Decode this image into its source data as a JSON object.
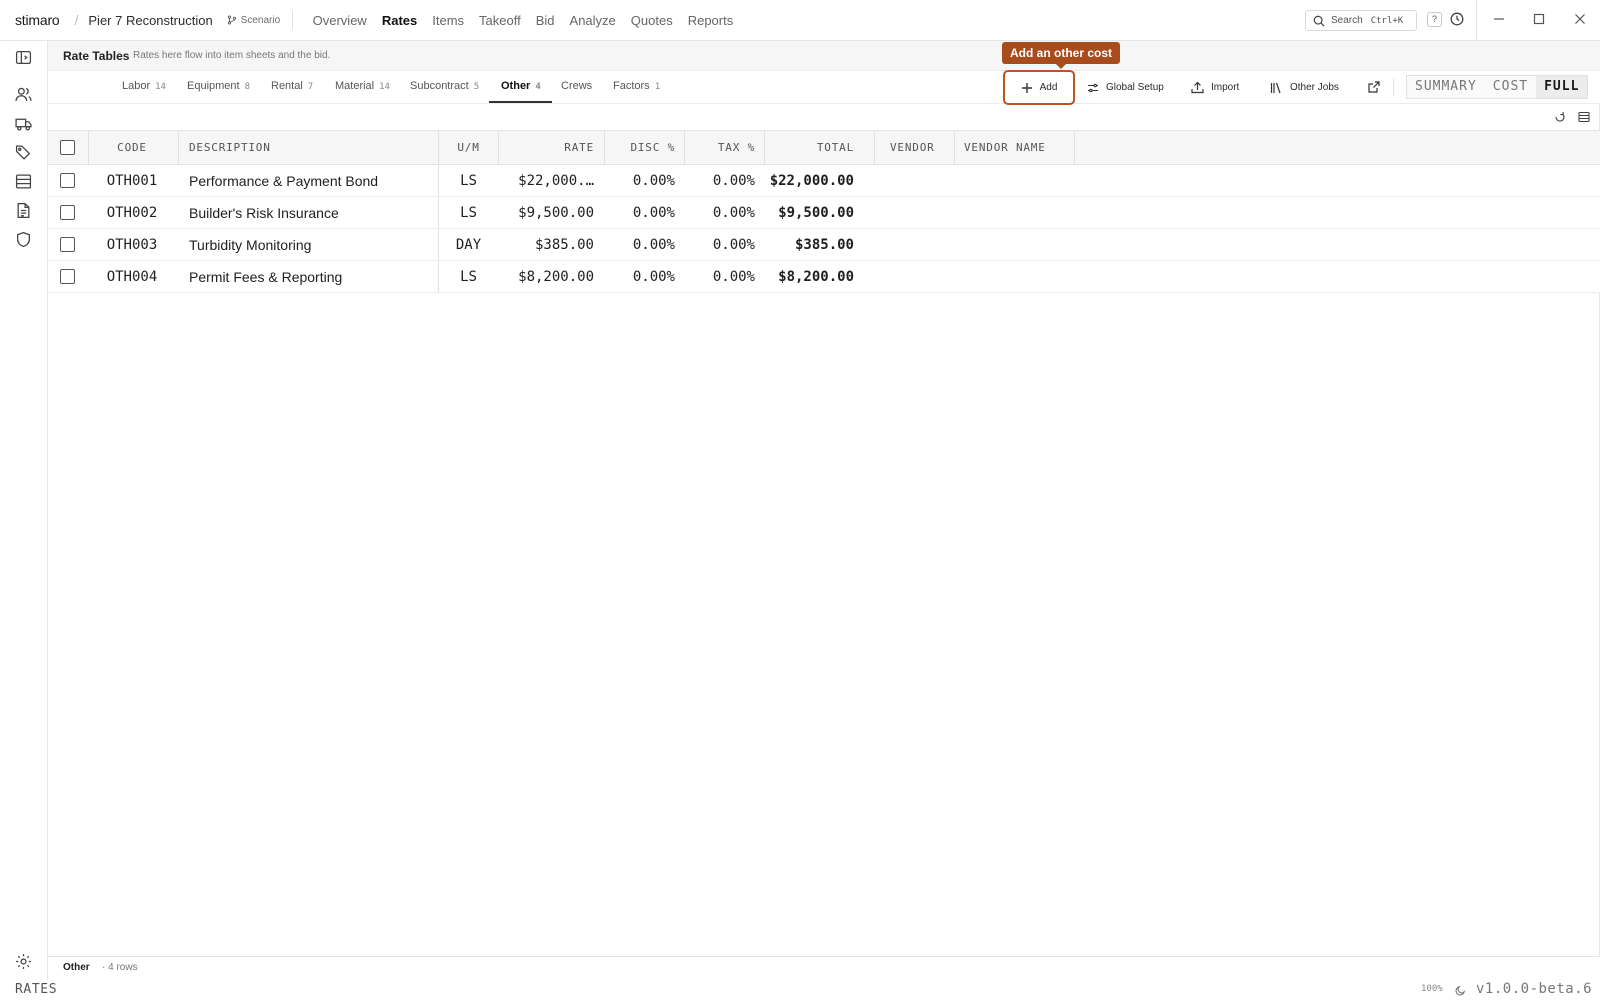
{
  "app": {
    "brand": "stimaro",
    "separator": "/",
    "project": "Pier 7 Reconstruction",
    "scenario": "Scenario"
  },
  "nav": [
    "Overview",
    "Rates",
    "Items",
    "Takeoff",
    "Bid",
    "Analyze",
    "Quotes",
    "Reports"
  ],
  "nav_active": "Rates",
  "search": {
    "label": "Search",
    "shortcut": "Ctrl+K"
  },
  "help_label": "?",
  "header": {
    "title": "Rate Tables",
    "subtitle": "Rates here flow into item sheets and the bid."
  },
  "tabs": [
    {
      "label": "Labor",
      "count": "14"
    },
    {
      "label": "Equipment",
      "count": "8"
    },
    {
      "label": "Rental",
      "count": "7"
    },
    {
      "label": "Material",
      "count": "14"
    },
    {
      "label": "Subcontract",
      "count": "5"
    },
    {
      "label": "Other",
      "count": "4"
    },
    {
      "label": "Crews",
      "count": ""
    },
    {
      "label": "Factors",
      "count": "1"
    }
  ],
  "active_tab": "Other",
  "toolbar": {
    "tooltip": "Add an other cost",
    "add": "Add",
    "global_setup": "Global Setup",
    "import": "Import",
    "other_jobs": "Other Jobs"
  },
  "view_modes": [
    "SUMMARY",
    "COST",
    "FULL"
  ],
  "view_active": "FULL",
  "table": {
    "columns": {
      "code": "CODE",
      "description": "DESCRIPTION",
      "um": "U/M",
      "rate": "RATE",
      "disc": "DISC %",
      "tax": "TAX %",
      "total": "TOTAL",
      "vendor": "VENDOR",
      "vendor_name": "VENDOR NAME"
    },
    "rows": [
      {
        "code": "OTH001",
        "description": "Performance & Payment Bond",
        "um": "LS",
        "rate": "$22,000.…",
        "disc": "0.00%",
        "tax": "0.00%",
        "total": "$22,000.00",
        "vendor": "",
        "vendor_name": ""
      },
      {
        "code": "OTH002",
        "description": "Builder's Risk Insurance",
        "um": "LS",
        "rate": "$9,500.00",
        "disc": "0.00%",
        "tax": "0.00%",
        "total": "$9,500.00",
        "vendor": "",
        "vendor_name": ""
      },
      {
        "code": "OTH003",
        "description": "Turbidity Monitoring",
        "um": "DAY",
        "rate": "$385.00",
        "disc": "0.00%",
        "tax": "0.00%",
        "total": "$385.00",
        "vendor": "",
        "vendor_name": ""
      },
      {
        "code": "OTH004",
        "description": "Permit Fees & Reporting",
        "um": "LS",
        "rate": "$8,200.00",
        "disc": "0.00%",
        "tax": "0.00%",
        "total": "$8,200.00",
        "vendor": "",
        "vendor_name": ""
      }
    ]
  },
  "footer": {
    "label": "Other",
    "rows": "· 4 rows"
  },
  "status": {
    "section": "RATES",
    "zoom": "100%",
    "version": "v1.0.0-beta.6"
  },
  "colors": {
    "accent": "#a84c1e",
    "accent_border": "#b7561f"
  },
  "icons": {
    "rail": [
      "sidebar-toggle-icon",
      "people-icon",
      "truck-icon",
      "tags-icon",
      "table-icon",
      "document-icon",
      "shield-icon",
      "gear-icon"
    ],
    "window": [
      "minimize-icon",
      "maximize-icon",
      "close-icon"
    ]
  }
}
